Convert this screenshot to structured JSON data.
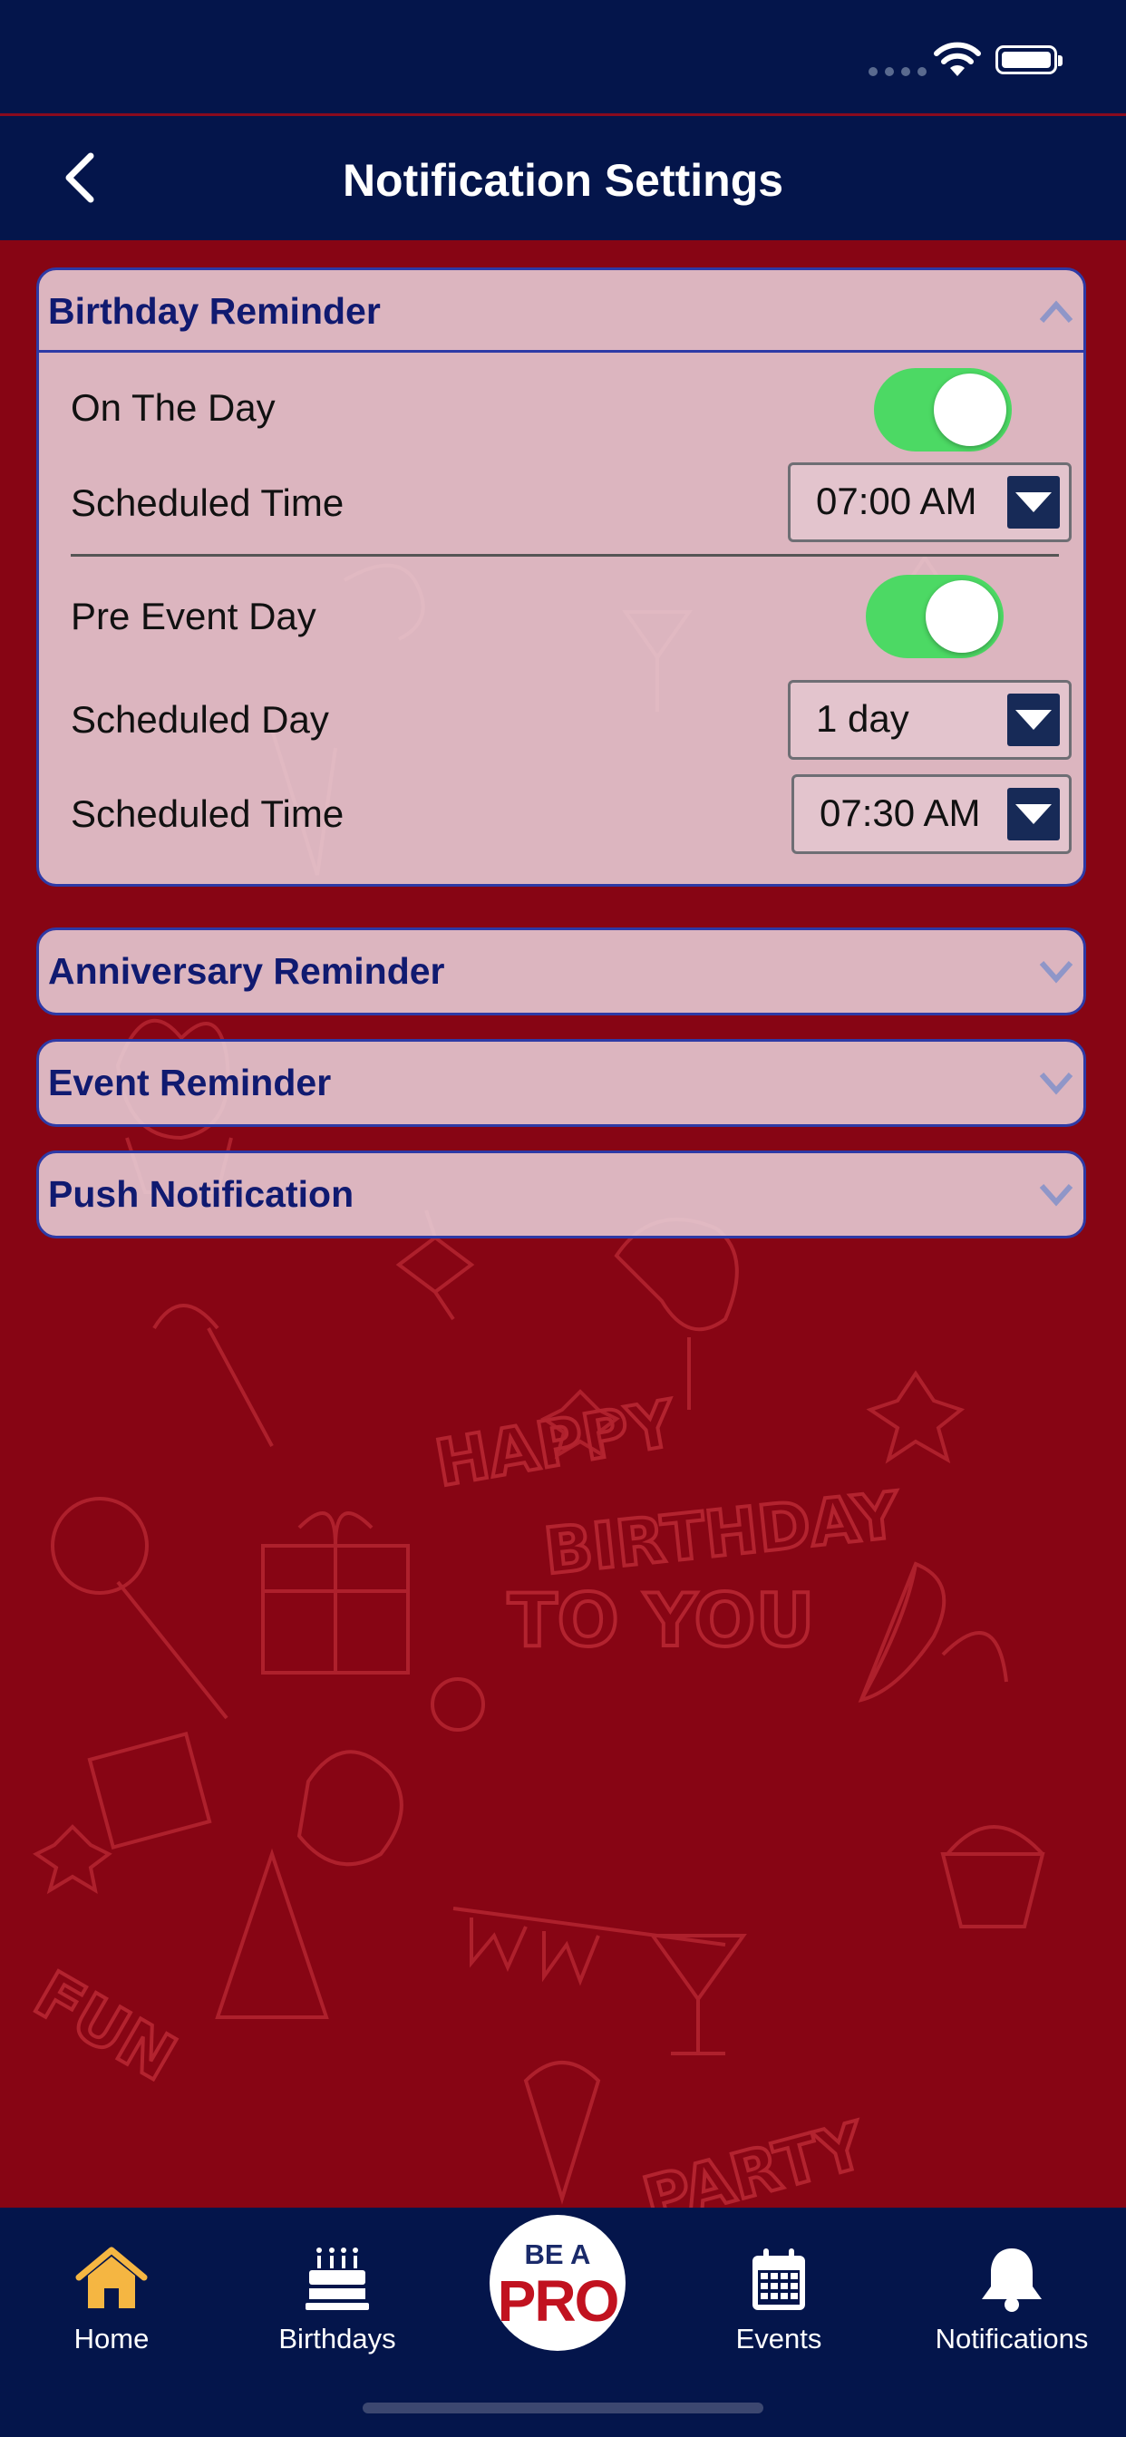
{
  "nav": {
    "title": "Notification Settings"
  },
  "sections": {
    "birthday": {
      "title": "Birthday Reminder",
      "on_the_day_label": "On The Day",
      "on_the_day_enabled": true,
      "scheduled_time_label": "Scheduled Time",
      "scheduled_time_value": "07:00 AM",
      "pre_event_label": "Pre Event Day",
      "pre_event_enabled": true,
      "scheduled_day_label": "Scheduled Day",
      "scheduled_day_value": "1 day",
      "pre_scheduled_time_label": "Scheduled Time",
      "pre_scheduled_time_value": "07:30 AM"
    },
    "anniversary": {
      "title": "Anniversary Reminder"
    },
    "event": {
      "title": "Event Reminder"
    },
    "push": {
      "title": "Push Notification"
    }
  },
  "background_text": [
    "HAPPY",
    "BIRTHDAY",
    "TO YOU",
    "FUN",
    "PARTY"
  ],
  "tabbar": {
    "home": "Home",
    "birthdays": "Birthdays",
    "pro_line1": "BE A",
    "pro_line2": "PRO",
    "events": "Events",
    "notifications": "Notifications"
  },
  "colors": {
    "nav_bg": "#04154b",
    "page_bg": "#870514",
    "accent": "#101a70",
    "toggle_on": "#4cd964",
    "home_active": "#f5b642"
  }
}
